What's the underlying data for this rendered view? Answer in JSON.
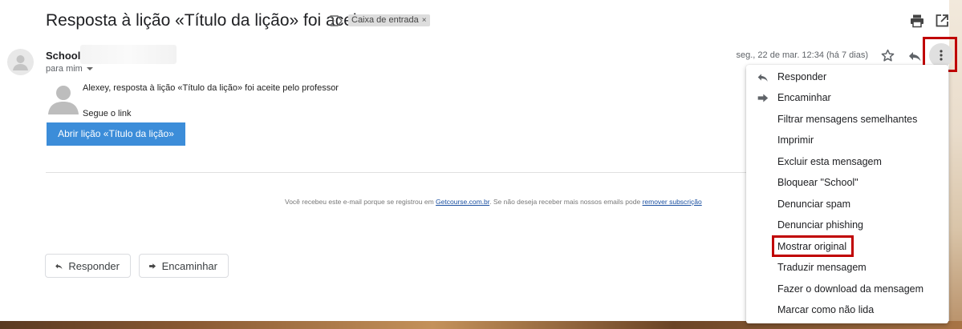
{
  "email": {
    "subject": "Resposta à lição «Título da lição» foi aceite",
    "label": "Caixa de entrada",
    "label_remove": "×",
    "sender": "School",
    "recipient": "para mim",
    "date": "seg., 22 de mar. 12:34 (há 7 dias)",
    "greeting": "Alexey, resposta à lição «Título da lição» foi aceite pelo professor",
    "follow_text": "Segue o link",
    "cta_label": "Abrir lição «Título da lição»",
    "footer": {
      "prefix": "Você recebeu este e-mail porque se registrou em ",
      "site_link": "Getcourse.com.br",
      "middle": ". Se não deseja receber mais nossos emails pode ",
      "unsubscribe_link": "remover subscrição"
    }
  },
  "actions": {
    "reply": "Responder",
    "forward": "Encaminhar"
  },
  "menu": {
    "items": [
      {
        "label": "Responder",
        "icon": "reply-icon"
      },
      {
        "label": "Encaminhar",
        "icon": "forward-icon"
      },
      {
        "label": "Filtrar mensagens semelhantes"
      },
      {
        "label": "Imprimir"
      },
      {
        "label": "Excluir esta mensagem"
      },
      {
        "label": "Bloquear \"School\""
      },
      {
        "label": "Denunciar spam"
      },
      {
        "label": "Denunciar phishing"
      },
      {
        "label": "Mostrar original",
        "highlighted": true
      },
      {
        "label": "Traduzir mensagem"
      },
      {
        "label": "Fazer o download da mensagem"
      },
      {
        "label": "Marcar como não lida"
      }
    ]
  },
  "colors": {
    "primary_button": "#3c8dd9",
    "highlight": "#c00000",
    "link": "#1a4fa0"
  }
}
